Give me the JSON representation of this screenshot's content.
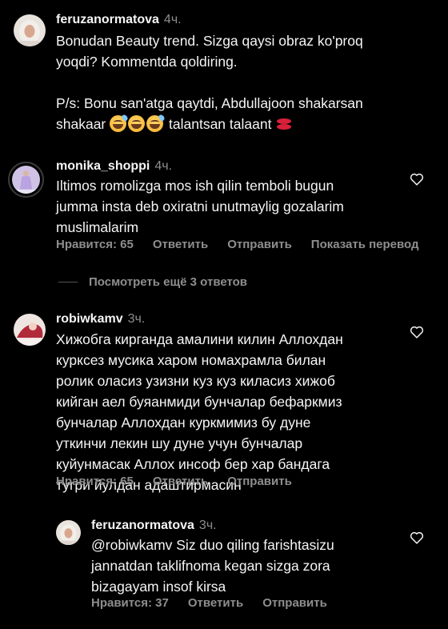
{
  "comments": [
    {
      "username": "feruzanormatova",
      "time": "4ч.",
      "lines": [
        "Bonudan Beauty trend. Sizga qaysi obraz ko'proq",
        "yoqdi? Kommentda qoldiring."
      ],
      "ps_lines": [
        "P/s: Bonu san'atga qaytdi, Abdullajoon shakarsan",
        "shakaar"
      ],
      "ps_tail": "talantsan talaant",
      "emoji_names": [
        "sweat-smile-emoji",
        "grin-emoji",
        "sweat-smile-emoji",
        "kiss-mark-emoji"
      ]
    },
    {
      "username": "monika_shoppi",
      "time": "4ч.",
      "lines": [
        "Iltimos romolizga mos ish qilin temboli bugun",
        "jumma insta deb oxiratni unutmaylig gozalarim",
        "muslimalarim"
      ],
      "actions": {
        "likes": "Нравится: 65",
        "reply": "Ответить",
        "send": "Отправить",
        "translate": "Показать перевод"
      }
    },
    {
      "username": "robiwkamv",
      "time": "3ч.",
      "lines": [
        "Хижобга кирганда амалини килин Аллохдан",
        "курксез мусика харом номахрамла билан",
        "ролик оласиз узизни куз куз киласиз хижоб",
        "кийган аел буяанмиди бунчалар бефаркмиз",
        "бунчалар Аллохдан куркмимиз бу дуне",
        "уткинчи лекин шу дуне учун бунчалар",
        "куйунмасак Аллох инсоф бер хар бандага",
        "тугри йулдан адаштирмасин"
      ],
      "actions": {
        "likes": "Нравится: 65",
        "reply": "Ответить",
        "send": "Отправить"
      }
    }
  ],
  "view_more_replies": "Посмотреть ещё 3 ответов",
  "reply": {
    "username": "feruzanormatova",
    "time": "3ч.",
    "lines": [
      "@robiwkamv Siz duo qiling farishtasizu",
      "jannatdan taklifnoma kegan sizga zora",
      "bizagayam insof kirsa"
    ],
    "actions": {
      "likes": "Нравится: 37",
      "reply": "Ответить",
      "send": "Отправить"
    }
  },
  "icons": {
    "like": "heart-outline-icon"
  },
  "colors": {
    "background": "#000000",
    "text": "#f5f5f5",
    "muted": "#8e8e8e",
    "story_ring": "#3a3a3a"
  }
}
